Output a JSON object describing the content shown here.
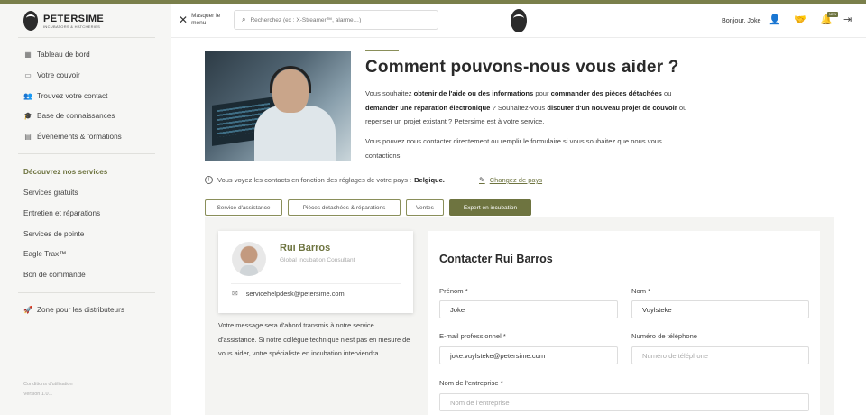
{
  "brand": {
    "name": "PETERSIME",
    "tagline": "INCUBATORS & HATCHERIES"
  },
  "sidebar": {
    "main_items": [
      {
        "label": "Tableau de bord",
        "icon": "dashboard-icon"
      },
      {
        "label": "Votre couvoir",
        "icon": "hatchery-icon"
      },
      {
        "label": "Trouvez votre contact",
        "icon": "contacts-icon"
      },
      {
        "label": "Base de connaissances",
        "icon": "graduation-cap-icon"
      },
      {
        "label": "Événements & formations",
        "icon": "calendar-icon"
      }
    ],
    "services_heading": "Découvrez nos services",
    "service_items": [
      "Services gratuits",
      "Entretien et réparations",
      "Services de pointe",
      "Eagle Trax™",
      "Bon de commande"
    ],
    "distributor_item": {
      "label": "Zone pour les distributeurs",
      "icon": "rocket-icon"
    },
    "footer": {
      "terms": "Conditions d'utilisation",
      "version": "Version 1.0.1"
    }
  },
  "header": {
    "hide_menu_label": "Masquer le menu",
    "search_placeholder": "Recherchez (ex : X-Streamer™, alarme…)",
    "greeting": "Bonjour, Joke",
    "new_badge": "NEW",
    "icons": [
      "user-settings-icon",
      "handshake-icon",
      "bell-icon",
      "logout-icon"
    ]
  },
  "main": {
    "title": "Comment pouvons-nous vous aider ?",
    "paragraph1": [
      {
        "text": "Vous souhaitez ",
        "bold": false
      },
      {
        "text": "obtenir de l'aide ou des informations",
        "bold": true
      },
      {
        "text": " pour ",
        "bold": false
      },
      {
        "text": "commander des pièces détachées",
        "bold": true
      },
      {
        "text": " ou ",
        "bold": false
      },
      {
        "text": "demander une réparation électronique",
        "bold": true
      },
      {
        "text": " ? Souhaitez-vous ",
        "bold": false
      },
      {
        "text": "discuter d'un nouveau projet de couvoir",
        "bold": true
      },
      {
        "text": " ou repenser un projet existant ? Petersime est à votre service.",
        "bold": false
      }
    ],
    "paragraph2": "Vous pouvez nous contacter directement ou remplir le formulaire si vous souhaitez que nous vous contactions.",
    "country_notice": "Vous voyez les contacts en fonction des réglages de votre pays :",
    "country": "Belgique.",
    "change_country": "Changez de pays",
    "tabs": [
      {
        "label": "Service d'assistance",
        "active": false
      },
      {
        "label": "Pièces détachées & réparations",
        "active": false
      },
      {
        "label": "Ventes",
        "active": false
      },
      {
        "label": "Expert en incubation",
        "active": true
      }
    ]
  },
  "contact": {
    "name": "Rui Barros",
    "role": "Global Incubation Consultant",
    "email": "servicehelpdesk@petersime.com",
    "note": "Votre message sera d'abord transmis à notre service d'assistance. Si notre collègue technique n'est pas en mesure de vous aider, votre spécialiste en incubation interviendra."
  },
  "form": {
    "title": "Contacter Rui Barros",
    "fields": {
      "first_name": {
        "label": "Prénom *",
        "value": "Joke",
        "placeholder": ""
      },
      "last_name": {
        "label": "Nom *",
        "value": "Vuylsteke",
        "placeholder": ""
      },
      "email": {
        "label": "E-mail professionnel *",
        "value": "joke.vuylsteke@petersime.com",
        "placeholder": ""
      },
      "phone": {
        "label": "Numéro de téléphone",
        "value": "",
        "placeholder": "Numéro de téléphone"
      },
      "company": {
        "label": "Nom de l'entreprise *",
        "value": "",
        "placeholder": "Nom de l'entreprise"
      }
    }
  },
  "colors": {
    "accent": "#6e7440",
    "accent_bar": "#7a7f4b",
    "sidebar_bg": "#f6f6f4"
  }
}
